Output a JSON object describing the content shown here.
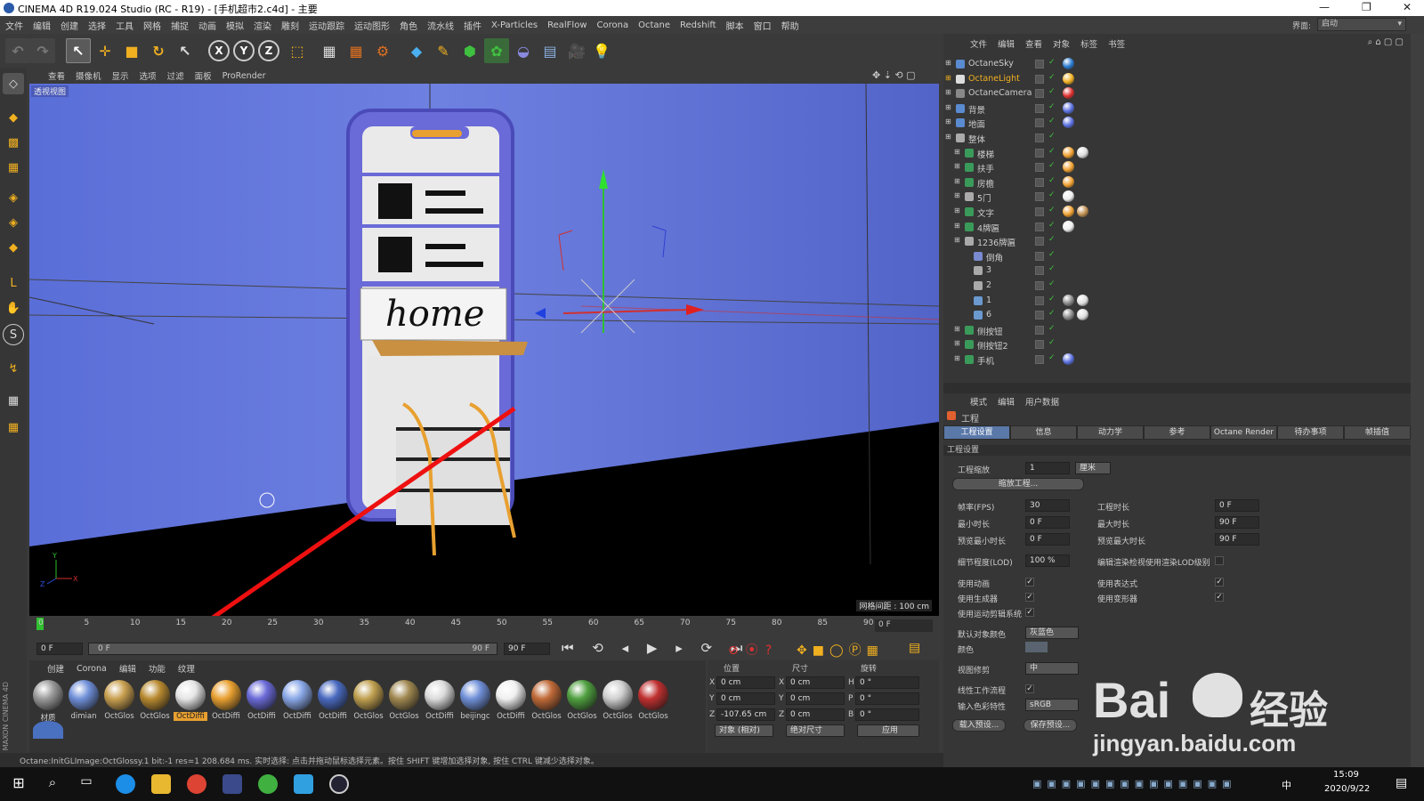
{
  "window": {
    "title": "CINEMA 4D R19.024 Studio (RC - R19) - [手机超市2.c4d] - 主要",
    "controls": [
      "—",
      "❐",
      "✕"
    ]
  },
  "menubar": [
    "文件",
    "编辑",
    "创建",
    "选择",
    "工具",
    "网格",
    "捕捉",
    "动画",
    "模拟",
    "渲染",
    "雕刻",
    "运动跟踪",
    "运动图形",
    "角色",
    "流水线",
    "插件",
    "X-Particles",
    "RealFlow",
    "Corona",
    "Octane",
    "Redshift",
    "脚本",
    "窗口",
    "帮助"
  ],
  "interface": {
    "label": "界面:",
    "value": "启动"
  },
  "viewport": {
    "menu": [
      "查看",
      "摄像机",
      "显示",
      "选项",
      "过滤",
      "面板",
      "ProRender"
    ],
    "label": "透视视图",
    "grid_info": "网格间距 : 100 cm",
    "sign_text": "home"
  },
  "timeline": {
    "ticks": [
      "0",
      "5",
      "10",
      "15",
      "20",
      "25",
      "30",
      "35",
      "40",
      "45",
      "50",
      "55",
      "60",
      "65",
      "70",
      "75",
      "80",
      "85",
      "90"
    ],
    "current_frame": "0 F",
    "start": "0 F",
    "range_start": "0 F",
    "range_end": "90 F",
    "end": "90 F"
  },
  "material_manager": {
    "menu": [
      "创建",
      "Corona",
      "编辑",
      "功能",
      "纹理"
    ],
    "materials": [
      {
        "name": "材质",
        "color": "#9a9a9a"
      },
      {
        "name": "dimian",
        "color": "#6f8fd8"
      },
      {
        "name": "OctGlos",
        "color": "#c9a050"
      },
      {
        "name": "OctGlos",
        "color": "#b88a30"
      },
      {
        "name": "OctDiffi",
        "color": "#e6e6e6",
        "selected": true
      },
      {
        "name": "OctDiffi",
        "color": "#e8a030"
      },
      {
        "name": "OctDiffi",
        "color": "#6a6ad8"
      },
      {
        "name": "OctDiffi",
        "color": "#8aa8e8"
      },
      {
        "name": "OctDiffi",
        "color": "#4a6ac0"
      },
      {
        "name": "OctGlos",
        "color": "#c0a050"
      },
      {
        "name": "OctGlos",
        "color": "#a08850"
      },
      {
        "name": "OctDiffi",
        "color": "#dcdcdc"
      },
      {
        "name": "beijingc",
        "color": "#7090d8"
      },
      {
        "name": "OctDiffi",
        "color": "#f0f0f0"
      },
      {
        "name": "OctGlos",
        "color": "#c06a38"
      },
      {
        "name": "OctGlos",
        "color": "#50a040"
      },
      {
        "name": "OctGlos",
        "color": "#d0d0d0"
      },
      {
        "name": "OctGlos",
        "color": "#c03030"
      }
    ],
    "extra_material_color": "#4a70c0"
  },
  "coordinates": {
    "headers": [
      "位置",
      "尺寸",
      "旋转"
    ],
    "rows": [
      {
        "a": "X",
        "pos": "0 cm",
        "b": "X",
        "size": "0 cm",
        "c": "H",
        "rot": "0 °"
      },
      {
        "a": "Y",
        "pos": "0 cm",
        "b": "Y",
        "size": "0 cm",
        "c": "P",
        "rot": "0 °"
      },
      {
        "a": "Z",
        "pos": "-107.65 cm",
        "b": "Z",
        "size": "0 cm",
        "c": "B",
        "rot": "0 °"
      }
    ],
    "mode1": "对象 (相对)",
    "mode2": "绝对尺寸",
    "apply": "应用"
  },
  "status": "Octane:InitGLImage:OctGlossy.1 bit:-1 res=1 208.684 ms.   实时选择: 点击并拖动鼠标选择元素。按住 SHIFT 键增加选择对象, 按住 CTRL 键减少选择对象。",
  "object_manager": {
    "menu": [
      "文件",
      "编辑",
      "查看",
      "对象",
      "标签",
      "书签"
    ],
    "objects": [
      {
        "name": "OctaneSky",
        "indent": 0,
        "icon": "#5a8ad0",
        "highlight": false
      },
      {
        "name": "OctaneLight",
        "indent": 0,
        "icon": "#ddd",
        "highlight": true
      },
      {
        "name": "OctaneCamera",
        "indent": 0,
        "icon": "#888",
        "highlight": false
      },
      {
        "name": "背景",
        "indent": 0,
        "icon": "#5a8ad0",
        "highlight": false
      },
      {
        "name": "地面",
        "indent": 0,
        "icon": "#5a8ad0",
        "highlight": false
      },
      {
        "name": "整体",
        "indent": 0,
        "icon": "#aaa",
        "highlight": false
      },
      {
        "name": "楼梯",
        "indent": 1,
        "icon": "#3a9a5a",
        "highlight": false
      },
      {
        "name": "扶手",
        "indent": 1,
        "icon": "#3a9a5a",
        "highlight": false
      },
      {
        "name": "房檐",
        "indent": 1,
        "icon": "#3a9a5a",
        "highlight": false
      },
      {
        "name": "5门",
        "indent": 1,
        "icon": "#aaa",
        "highlight": false
      },
      {
        "name": "文字",
        "indent": 1,
        "icon": "#3a9a5a",
        "highlight": false
      },
      {
        "name": "4牌匾",
        "indent": 1,
        "icon": "#3a9a5a",
        "highlight": false
      },
      {
        "name": "1236牌匾",
        "indent": 1,
        "icon": "#aaa",
        "highlight": false
      },
      {
        "name": "倒角",
        "indent": 2,
        "icon": "#7a8ad0",
        "highlight": false
      },
      {
        "name": "3",
        "indent": 2,
        "icon": "#aaa",
        "highlight": false
      },
      {
        "name": "2",
        "indent": 2,
        "icon": "#aaa",
        "highlight": false
      },
      {
        "name": "1",
        "indent": 2,
        "icon": "#6a9ad0",
        "highlight": false
      },
      {
        "name": "6",
        "indent": 2,
        "icon": "#6a9ad0",
        "highlight": false
      },
      {
        "name": "侧按钮",
        "indent": 1,
        "icon": "#3a9a5a",
        "highlight": false
      },
      {
        "name": "侧按钮2",
        "indent": 1,
        "icon": "#3a9a5a",
        "highlight": false
      },
      {
        "name": "手机",
        "indent": 1,
        "icon": "#3a9a5a",
        "highlight": false
      }
    ]
  },
  "attribute_manager": {
    "menu": [
      "模式",
      "编辑",
      "用户数据"
    ],
    "title": "工程",
    "tabs": [
      "工程设置",
      "信息",
      "动力学",
      "参考",
      "Octane Render",
      "待办事项",
      "帧插值"
    ],
    "section": "工程设置",
    "scale_label": "工程缩放",
    "scale_value": "1",
    "scale_unit": "厘米",
    "scale_button": "缩放工程...",
    "fps_label": "帧率(FPS)",
    "fps": "30",
    "duration_label": "工程时长",
    "duration": "0 F",
    "min_time_label": "最小时长",
    "min_time": "0 F",
    "max_time_label": "最大时长",
    "max_time": "90 F",
    "preview_min_label": "预览最小时长",
    "preview_min": "0 F",
    "preview_max_label": "预览最大时长",
    "preview_max": "90 F",
    "lod_label": "细节程度(LOD)",
    "lod": "100 %",
    "render_lod_label": "编辑渲染检视使用渲染LOD级别",
    "use_anim": "使用动画",
    "use_expr": "使用表达式",
    "use_gen": "使用生成器",
    "use_deform": "使用变形器",
    "use_motion": "使用运动剪辑系统",
    "default_color_label": "默认对象颜色",
    "default_color": "灰蓝色",
    "color_label": "颜色",
    "view_clip_label": "视图修剪",
    "view_clip": "中",
    "linear_label": "线性工作流程",
    "input_color_label": "输入色彩特性",
    "input_color": "sRGB",
    "load_preset": "载入预设...",
    "save_preset": "保存预设..."
  },
  "taskbar": {
    "time": "15:09",
    "date": "2020/9/22",
    "ime": "中"
  },
  "watermark": {
    "brand": "Bai",
    "cn": "经验",
    "url": "jingyan.baidu.com"
  }
}
